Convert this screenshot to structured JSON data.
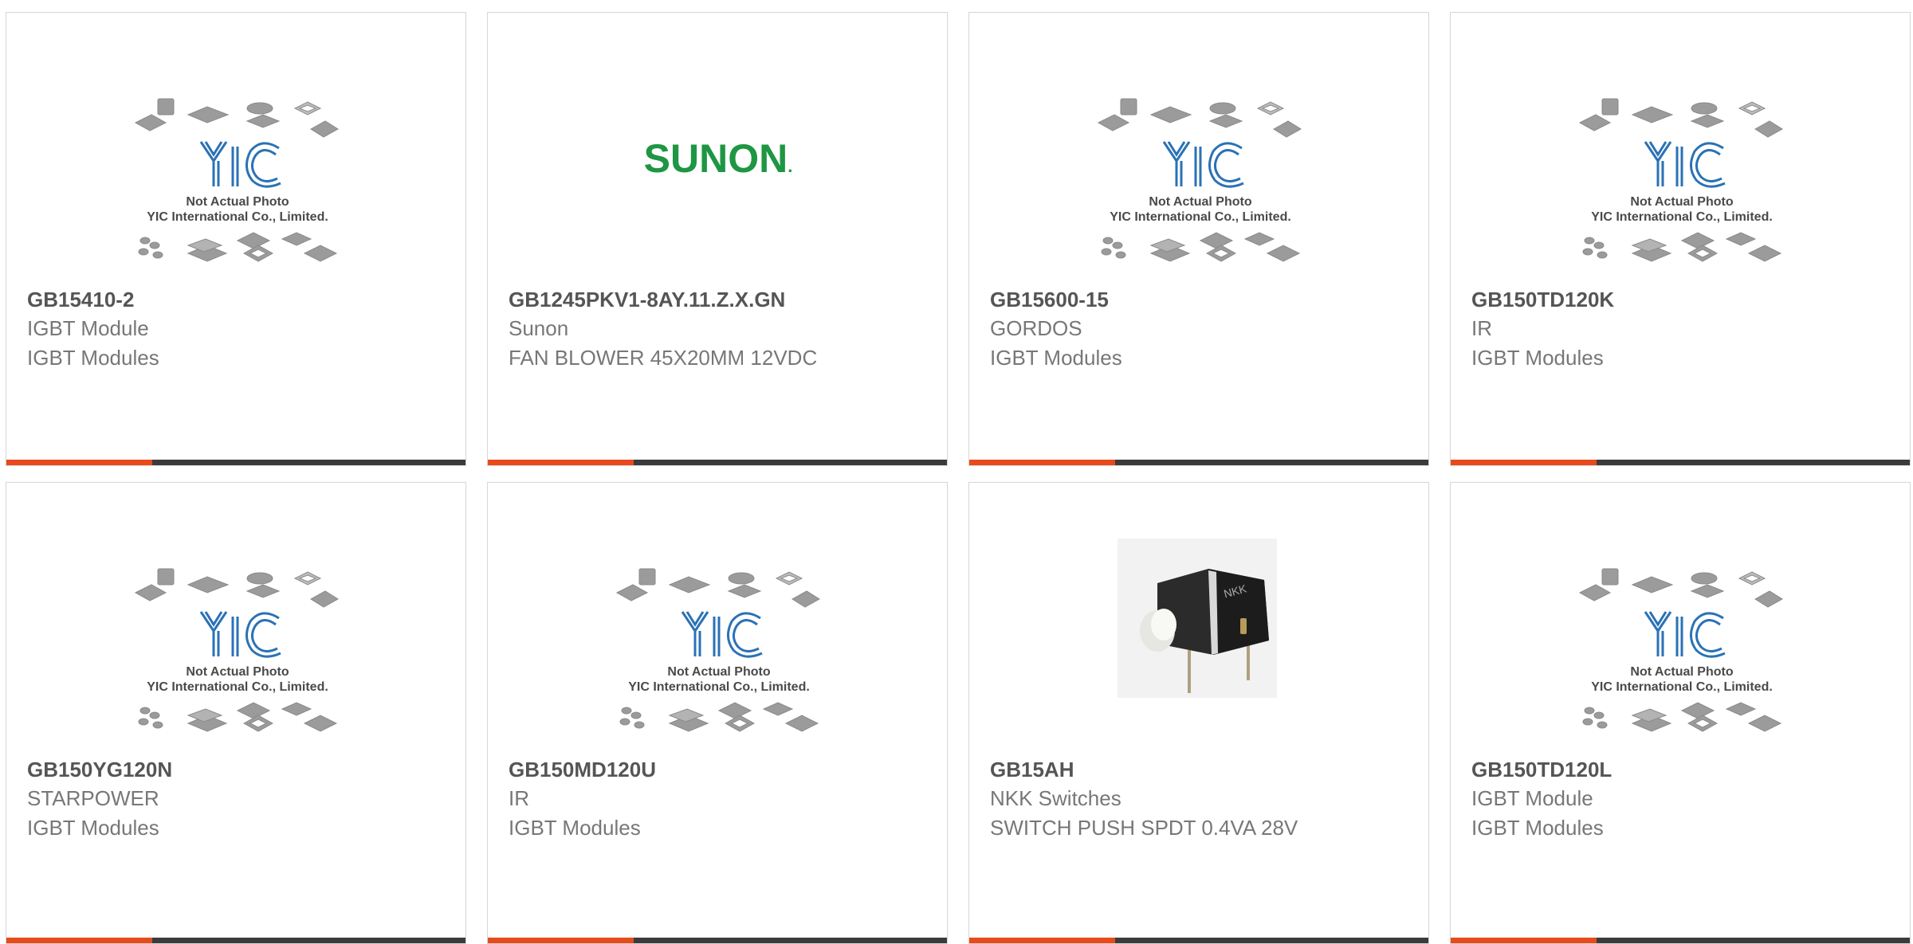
{
  "colors": {
    "accent": "#e84a1c",
    "bar": "#3b3b3b",
    "placeholder_blue": "#2a72b5",
    "sunon_green": "#1e9643"
  },
  "placeholder": {
    "logo": "YIC",
    "caption1": "Not Actual Photo",
    "caption2": "YIC International Co., Limited."
  },
  "sunon_logo": {
    "text": "SUNON",
    "dot": "."
  },
  "products": [
    {
      "part_number": "GB15410-2",
      "manufacturer": "IGBT Module",
      "description": "IGBT Modules",
      "image": "placeholder"
    },
    {
      "part_number": "GB1245PKV1-8AY.11.Z.X.GN",
      "manufacturer": "Sunon",
      "description": "FAN BLOWER 45X20MM 12VDC",
      "image": "sunon-logo"
    },
    {
      "part_number": "GB15600-15",
      "manufacturer": "GORDOS",
      "description": "IGBT Modules",
      "image": "placeholder"
    },
    {
      "part_number": "GB150TD120K",
      "manufacturer": "IR",
      "description": "IGBT Modules",
      "image": "placeholder"
    },
    {
      "part_number": "GB150YG120N",
      "manufacturer": "STARPOWER",
      "description": "IGBT Modules",
      "image": "placeholder"
    },
    {
      "part_number": "GB150MD120U",
      "manufacturer": "IR",
      "description": "IGBT Modules",
      "image": "placeholder"
    },
    {
      "part_number": "GB15AH",
      "manufacturer": "NKK Switches",
      "description": "SWITCH PUSH SPDT 0.4VA 28V",
      "image": "switch-photo"
    },
    {
      "part_number": "GB150TD120L",
      "manufacturer": "IGBT Module",
      "description": "IGBT Modules",
      "image": "placeholder"
    }
  ]
}
